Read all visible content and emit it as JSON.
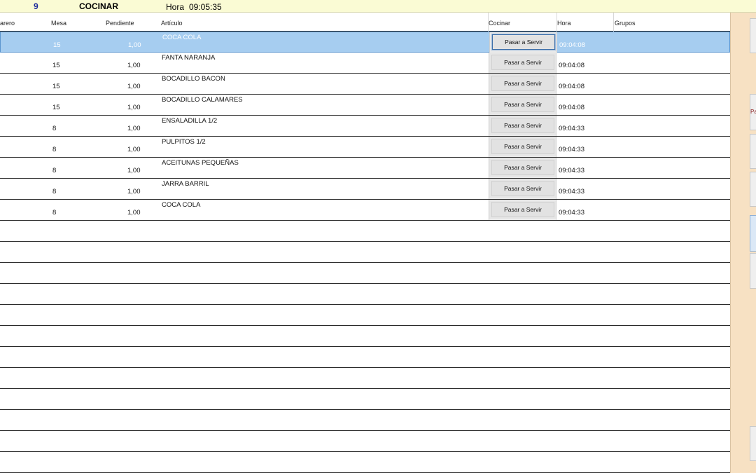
{
  "topbar": {
    "count": "9",
    "mode": "COCINAR",
    "hora_label": "Hora",
    "hora": "09:05:35"
  },
  "columns": {
    "camarero": "arero",
    "mesa": "Mesa",
    "pendiente": "Pendiente",
    "articulo": "Artículo",
    "cocinar": "Cocinar",
    "hora": "Hora",
    "grupos": "Grupos"
  },
  "rows": [
    {
      "mesa": "15",
      "pendiente": "1,00",
      "articulo": "COCA COLA",
      "action": "Pasar a Servir",
      "hora": "09:04:08"
    },
    {
      "mesa": "15",
      "pendiente": "1,00",
      "articulo": "FANTA NARANJA",
      "action": "Pasar a Servir",
      "hora": "09:04:08"
    },
    {
      "mesa": "15",
      "pendiente": "1,00",
      "articulo": "BOCADILLO BACON",
      "action": "Pasar a Servir",
      "hora": "09:04:08"
    },
    {
      "mesa": "15",
      "pendiente": "1,00",
      "articulo": "BOCADILLO CALAMARES",
      "action": "Pasar a Servir",
      "hora": "09:04:08"
    },
    {
      "mesa": "8",
      "pendiente": "1,00",
      "articulo": "ENSALADILLA 1/2",
      "action": "Pasar a Servir",
      "hora": "09:04:33"
    },
    {
      "mesa": "8",
      "pendiente": "1,00",
      "articulo": "PULPITOS 1/2",
      "action": "Pasar a Servir",
      "hora": "09:04:33"
    },
    {
      "mesa": "8",
      "pendiente": "1,00",
      "articulo": "ACEITUNAS PEQUEÑAS",
      "action": "Pasar a Servir",
      "hora": "09:04:33"
    },
    {
      "mesa": "8",
      "pendiente": "1,00",
      "articulo": "JARRA BARRIL",
      "action": "Pasar a Servir",
      "hora": "09:04:33"
    },
    {
      "mesa": "8",
      "pendiente": "1,00",
      "articulo": "COCA COLA",
      "action": "Pasar a Servir",
      "hora": "09:04:33"
    }
  ],
  "selected_row": 0,
  "side": {
    "label": "Pa"
  },
  "colors": {
    "topbar_bg": "#fafbd4",
    "count_text": "#1d2b9c",
    "selected_row": "#a6cdf0",
    "side_panel": "#f7e1c3",
    "side_label": "#8b1a1a"
  }
}
